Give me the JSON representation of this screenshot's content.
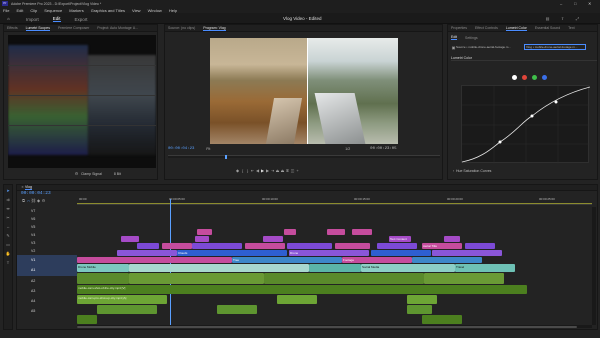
{
  "app": {
    "title": "Adobe Premiere Pro 2023 - D:\\Export\\Project\\Vlog Video *",
    "window_controls": [
      "–",
      "□",
      "✕"
    ]
  },
  "menu": [
    "File",
    "Edit",
    "Clip",
    "Sequence",
    "Markers",
    "Graphics and Titles",
    "View",
    "Window",
    "Help"
  ],
  "workspace": {
    "tabs": [
      "Import",
      "Edit",
      "Export"
    ],
    "active": "Edit",
    "center_title": "Vlog Video - Edited"
  },
  "left_panel": {
    "tabs": [
      "Effects",
      "Lumetri Scopes",
      "Premiere Composer",
      "Project: Auto Montage U..."
    ],
    "scope_setting": "Clamp Signal",
    "scope_value": "8 Bit"
  },
  "monitor": {
    "tabs": [
      "Source: (no clips)",
      "Program: Vlog"
    ],
    "timecode_left": "00:00:04:23",
    "fit": "Fit",
    "quality": "1/2",
    "timecode_right": "00:00:23:05"
  },
  "right_panel": {
    "tabs": [
      "Properties",
      "Effect Controls",
      "Lumetri Color",
      "Essential Sound",
      "Text"
    ],
    "subtabs": [
      "Edit",
      "Settings"
    ],
    "source_label": "Source • mobile-drone-aerial-footage.m...",
    "clip_label": "Vlog • mobile-drone-aerial-footage.m...",
    "section": "Lumetri Color",
    "curve_section": "Hue Saturation Curves",
    "curve_dot_colors": [
      "#ffffff",
      "#e0453a",
      "#3fbf4a",
      "#3a6fe8"
    ]
  },
  "timeline": {
    "tabs": [
      "Vlog"
    ],
    "timecode": "00:00:04:23",
    "ruler_labels": [
      "00:00",
      "00:00:05:00",
      "00:00:10:00",
      "00:00:15:00",
      "00:00:20:00",
      "00:00:25:00"
    ],
    "tracks_video": [
      "V7",
      "V6",
      "V5",
      "V4",
      "V3",
      "V2",
      "V1"
    ],
    "tracks_audio": [
      "A1",
      "A2",
      "A3",
      "A4",
      "A5"
    ],
    "clip_labels": [
      "Clouds",
      "Drone",
      "Text Content",
      "Aerial Title",
      "Tree",
      "Footage",
      "Social Media",
      "Drone Mobile",
      "Travel"
    ],
    "audio_label": "mobile-cam-shot-of-the-city.mp4 [V]",
    "audio_label2": "mobile-cam-pro-shot-up-city.mp4 [A]"
  }
}
